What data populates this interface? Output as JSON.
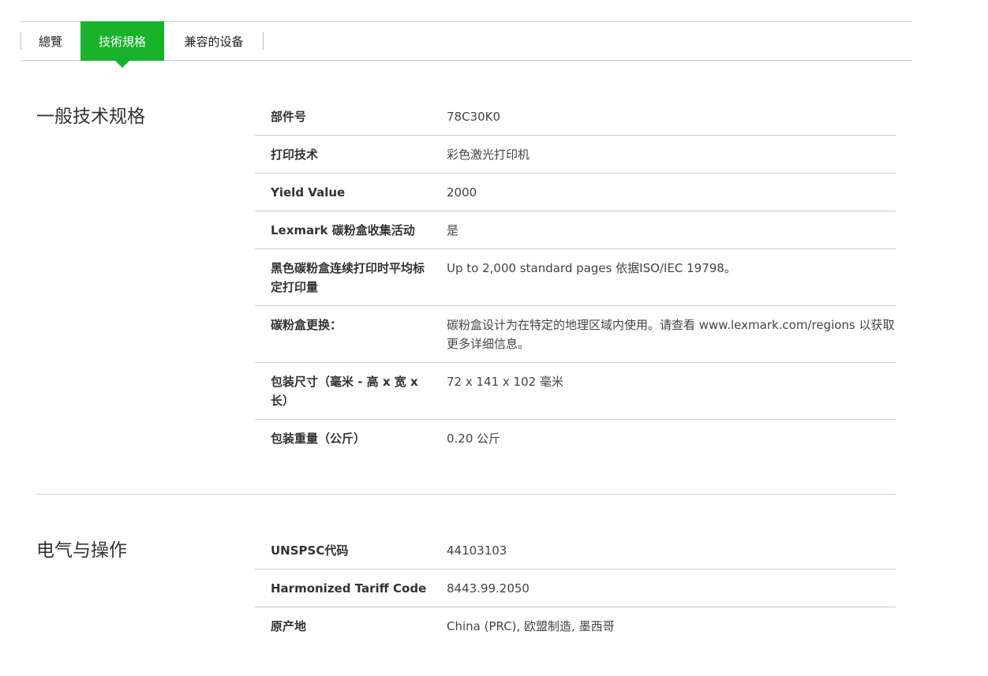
{
  "tabs": [
    {
      "label": "總覽",
      "active": false
    },
    {
      "label": "技術規格",
      "active": true
    },
    {
      "label": "兼容的设备",
      "active": false
    }
  ],
  "accent_color": "#19b32b",
  "sections": [
    {
      "title": "一般技术规格",
      "rows": [
        {
          "key": "部件号",
          "value": "78C30K0"
        },
        {
          "key": "打印技术",
          "value": "彩色激光打印机"
        },
        {
          "key": "Yield Value",
          "value": "2000"
        },
        {
          "key": "Lexmark 碳粉盒收集活动",
          "value": "是"
        },
        {
          "key": "黑色碳粉盒连续打印时平均标定打印量",
          "value": "Up to 2,000 standard pages 依据ISO/IEC 19798。"
        },
        {
          "key": "碳粉盒更换：",
          "value": "碳粉盒设计为在特定的地理区域内使用。请查看 www.lexmark.com/regions 以获取更多详细信息。"
        },
        {
          "key": "包装尺寸（毫米 - 高 x 宽 x 长）",
          "value": "72 x 141 x 102 毫米"
        },
        {
          "key": "包装重量（公斤）",
          "value": "0.20 公斤"
        }
      ]
    },
    {
      "title": "电气与操作",
      "rows": [
        {
          "key": "UNSPSC代码",
          "value": "44103103"
        },
        {
          "key": "Harmonized Tariff Code",
          "value": "8443.99.2050"
        },
        {
          "key": "原产地",
          "value": "China (PRC), 欧盟制造, 墨西哥"
        }
      ]
    }
  ]
}
